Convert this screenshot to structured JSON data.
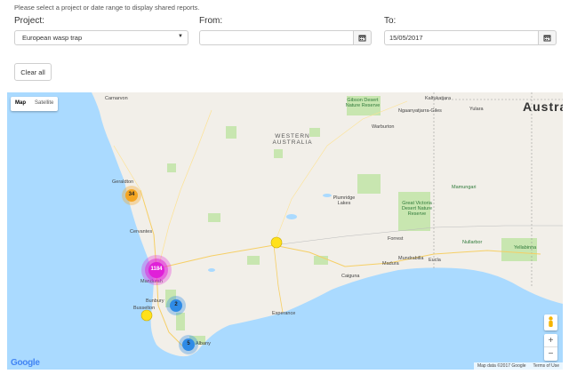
{
  "intro": "Please select a project or date range to display shared reports.",
  "filters": {
    "project_label": "Project:",
    "project_value": "European wasp trap",
    "from_label": "From:",
    "from_value": "",
    "to_label": "To:",
    "to_value": "15/05/2017"
  },
  "clear_label": "Clear all",
  "map": {
    "type_map": "Map",
    "type_satellite": "Satellite",
    "places": {
      "carnarvon": "Carnarvon",
      "gibson_desert": "Gibson Desert Nature Reserve",
      "kaltukatjara": "Kaltukatjara",
      "ngaanyatjarra": "Ngaanyatjarra-Giles",
      "yulara": "Yulara",
      "australia": "Austral",
      "western_australia": "WESTERN AUSTRALIA",
      "warburton": "Warburton",
      "plumridge": "Plumridge Lakes",
      "great_victoria": "Great Victoria Desert Nature Reserve",
      "mamungari": "Mamungari",
      "geraldton": "Geraldton",
      "cervantes": "Cervantes",
      "forrest": "Forrest",
      "nullarbor": "Nullarbor",
      "yellabinna": "Yellabinna",
      "madura": "Madura",
      "mundrabilla": "Mundrabilla",
      "eucla": "Eucla",
      "caiguna": "Caiguna",
      "mandurah": "Mandurah",
      "bunbury": "Bunbury",
      "busselton": "Busselton",
      "esperance": "Esperance",
      "albany": "Albany"
    },
    "markers": [
      {
        "id": "geraldton",
        "count": "34",
        "color": "#f5a623"
      },
      {
        "id": "perth",
        "count": "1184",
        "color": "#e020d8"
      },
      {
        "id": "bunbury",
        "count": "2",
        "color": "#2f8be6"
      },
      {
        "id": "albany",
        "count": "5",
        "color": "#2f8be6"
      },
      {
        "id": "kalgoorlie",
        "count": "",
        "color": "#ffe11c"
      },
      {
        "id": "busselton",
        "count": "",
        "color": "#ffe11c"
      }
    ],
    "attribution": "Map data ©2017 Google",
    "terms": "Terms of Use",
    "google": "Google",
    "zoom_in": "+",
    "zoom_out": "−"
  }
}
